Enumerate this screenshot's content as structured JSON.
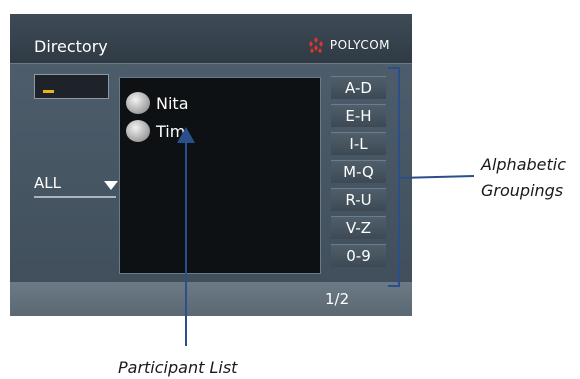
{
  "header": {
    "title": "Directory",
    "brand": "POLYCOM"
  },
  "filter": {
    "selected": "ALL"
  },
  "participants": [
    {
      "name": "Nita",
      "icon": "presence-icon"
    },
    {
      "name": "Tim",
      "icon": "presence-icon"
    }
  ],
  "groups": [
    "A-D",
    "E-H",
    "I-L",
    "M-Q",
    "R-U",
    "V-Z",
    "0-9"
  ],
  "pagination": {
    "label": "1/2"
  },
  "annotations": {
    "groupings_line1": "Alphabetic",
    "groupings_line2": "Groupings",
    "participant_list": "Participant List"
  },
  "colors": {
    "caret": "#e8b51a",
    "brand_red": "#d8382d",
    "annotation_line": "#2a4f8c"
  }
}
